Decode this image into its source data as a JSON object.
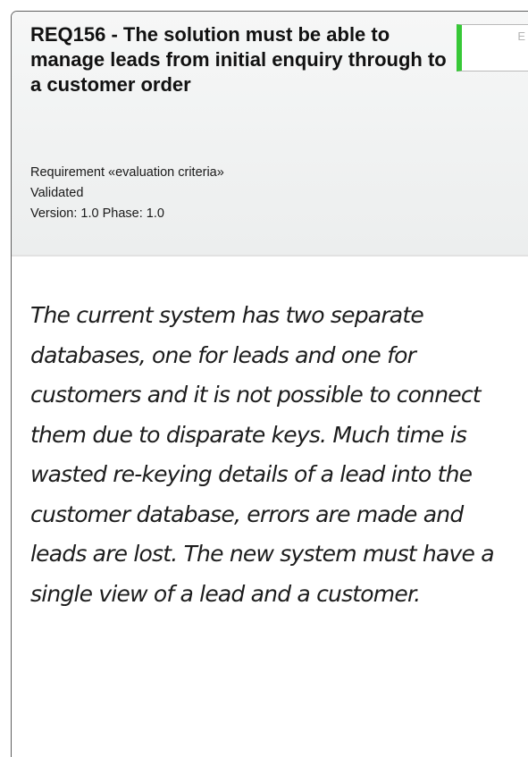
{
  "requirement": {
    "title": "REQ156 - The solution must be able to manage leads from initial enquiry through to a customer order",
    "type_line": "Requirement «evaluation criteria»",
    "status_line": "Validated",
    "version_line": "Version: 1.0 Phase: 1.0",
    "status_box_label": "E",
    "status_color": "#37c837",
    "notes": "The current system has two separate databases, one for leads and one for customers and it is not possible to connect them due to disparate keys. Much time is wasted re-keying details of a lead into the customer database, errors are made and leads are lost. The new system must have a single view of a lead and a customer."
  }
}
